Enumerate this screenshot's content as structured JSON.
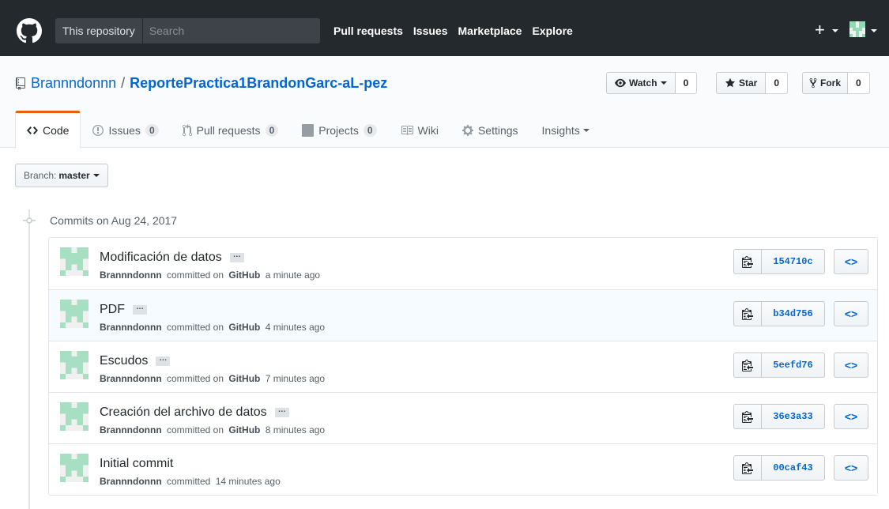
{
  "header": {
    "scope_label": "This repository",
    "search_placeholder": "Search",
    "nav": [
      "Pull requests",
      "Issues",
      "Marketplace",
      "Explore"
    ],
    "plus_symbol": "+",
    "brand_color": "#24292e"
  },
  "repo": {
    "owner": "Brannndonnn",
    "separator": "/",
    "name": "ReportePractica1BrandonGarc-aL-pez",
    "watch_label": "Watch",
    "watch_count": "0",
    "star_label": "Star",
    "star_count": "0",
    "fork_label": "Fork",
    "fork_count": "0"
  },
  "tabs": {
    "code": "Code",
    "issues": "Issues",
    "issues_count": "0",
    "pulls": "Pull requests",
    "pulls_count": "0",
    "projects": "Projects",
    "projects_count": "0",
    "wiki": "Wiki",
    "settings": "Settings",
    "insights": "Insights"
  },
  "branch": {
    "label": "Branch:",
    "value": "master"
  },
  "commits": {
    "group_title": "Commits on Aug 24, 2017",
    "ellipsis": "…",
    "items": [
      {
        "message": "Modificación de datos",
        "author": "Brannndonnn",
        "meta_mid": "committed on",
        "platform": "GitHub",
        "time": "a minute ago",
        "sha": "154710c",
        "has_ellipsis": true
      },
      {
        "message": "PDF",
        "author": "Brannndonnn",
        "meta_mid": "committed on",
        "platform": "GitHub",
        "time": "4 minutes ago",
        "sha": "b34d756",
        "has_ellipsis": true
      },
      {
        "message": "Escudos",
        "author": "Brannndonnn",
        "meta_mid": "committed on",
        "platform": "GitHub",
        "time": "7 minutes ago",
        "sha": "5eefd76",
        "has_ellipsis": true
      },
      {
        "message": "Creación del archivo de datos",
        "author": "Brannndonnn",
        "meta_mid": "committed on",
        "platform": "GitHub",
        "time": "8 minutes ago",
        "sha": "36e3a33",
        "has_ellipsis": true
      },
      {
        "message": "Initial commit",
        "author": "Brannndonnn",
        "meta_mid": "committed",
        "platform": "",
        "time": "14 minutes ago",
        "sha": "00caf43",
        "has_ellipsis": false
      }
    ],
    "browse_symbol": "<>"
  }
}
